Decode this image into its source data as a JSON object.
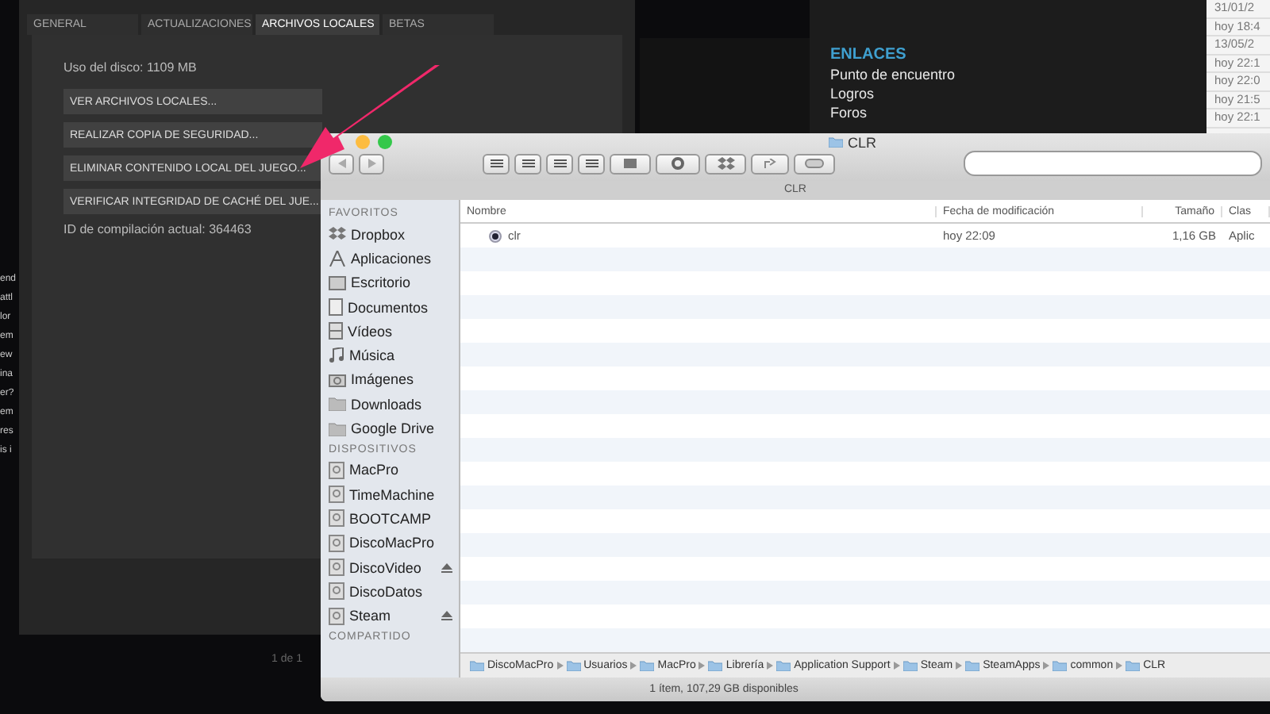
{
  "left_fragments": [
    "end",
    "attl",
    "lor",
    "em",
    "ew",
    "ina",
    "er?",
    "em",
    "res",
    "is i"
  ],
  "steam_properties": {
    "tabs": [
      {
        "label": "GENERAL",
        "selected": false
      },
      {
        "label": "ACTUALIZACIONES",
        "selected": false
      },
      {
        "label": "ARCHIVOS LOCALES",
        "selected": true
      },
      {
        "label": "BETAS",
        "selected": false
      }
    ],
    "disk_usage": "Uso del disco: 1109 MB",
    "buttons": [
      "VER ARCHIVOS LOCALES...",
      "REALIZAR COPIA DE SEGURIDAD...",
      "ELIMINAR CONTENIDO LOCAL DEL JUEGO...",
      "VERIFICAR INTEGRIDAD DE CACHÉ DEL JUE..."
    ],
    "build_id": "ID de compilación actual: 364463",
    "pager": "1 de 1"
  },
  "links": {
    "title": "ENLACES",
    "items": [
      "Punto de encuentro",
      "Logros",
      "Foros"
    ]
  },
  "dates": [
    "31/01/2",
    "hoy 18:4",
    "13/05/2",
    "hoy 22:1",
    "hoy 22:0",
    "hoy 21:5",
    "hoy 22:1"
  ],
  "finder": {
    "title": "CLR",
    "path_tab": "CLR",
    "sidebar": [
      {
        "heading": "FAVORITOS",
        "items": [
          {
            "label": "Dropbox",
            "eject": false
          },
          {
            "label": "Aplicaciones",
            "eject": false
          },
          {
            "label": "Escritorio",
            "eject": false
          },
          {
            "label": "Documentos",
            "eject": false
          },
          {
            "label": "Vídeos",
            "eject": false
          },
          {
            "label": "Música",
            "eject": false
          },
          {
            "label": "Imágenes",
            "eject": false
          },
          {
            "label": "Downloads",
            "eject": false
          },
          {
            "label": "Google Drive",
            "eject": false
          }
        ]
      },
      {
        "heading": "DISPOSITIVOS",
        "items": [
          {
            "label": "MacPro",
            "eject": false
          },
          {
            "label": "TimeMachine",
            "eject": false
          },
          {
            "label": "BOOTCAMP",
            "eject": false
          },
          {
            "label": "DiscoMacPro",
            "eject": false
          },
          {
            "label": "DiscoVideo",
            "eject": true
          },
          {
            "label": "DiscoDatos",
            "eject": false
          },
          {
            "label": "Steam",
            "eject": true
          }
        ]
      },
      {
        "heading": "COMPARTIDO"
      }
    ],
    "table": {
      "columns": [
        "Nombre",
        "Fecha de modificación",
        "Tamaño",
        "Clas"
      ],
      "rows": [
        {
          "name": "clr",
          "modified": "hoy 22:09",
          "size": "1,16 GB",
          "kind": "Aplic"
        }
      ]
    },
    "path": [
      "DiscoMacPro",
      "Usuarios",
      "MacPro",
      "Librería",
      "Application Support",
      "Steam",
      "SteamApps",
      "common",
      "CLR"
    ],
    "status": "1 ítem, 107,29 GB disponibles"
  }
}
